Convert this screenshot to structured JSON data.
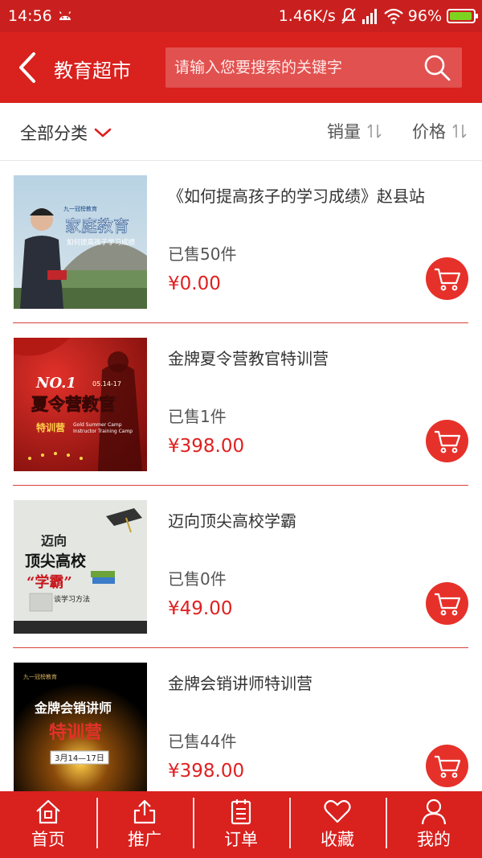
{
  "status_bar": {
    "time": "14:56",
    "network_speed": "1.46K/s",
    "battery": "96%"
  },
  "header": {
    "title": "教育超市",
    "search_placeholder": "请输入您要搜索的关键字"
  },
  "filter_bar": {
    "category_label": "全部分类",
    "sort_sales_label": "销量",
    "sort_price_label": "价格"
  },
  "products": [
    {
      "name": "《如何提高孩子的学习成绩》赵县站",
      "sold": "已售50件",
      "price": "¥0.00",
      "thumb_text": {
        "logo": "九一冠榜教育",
        "title": "家庭教育",
        "subtitle": "如何提高孩子学习成绩"
      }
    },
    {
      "name": "金牌夏令营教官特训营",
      "sold": "已售1件",
      "price": "¥398.00",
      "thumb_text": {
        "no1": "NO.1",
        "date": "05.14-17",
        "title": "夏令营教官",
        "sub": "特训营",
        "en1": "Gold Summer Camp",
        "en2": "Instructor Training Camp"
      }
    },
    {
      "name": "迈向顶尖高校学霸",
      "sold": "已售0件",
      "price": "¥49.00",
      "thumb_text": {
        "line1": "迈向",
        "line2": "顶尖高校",
        "line3": "“学霸”",
        "line4": "谈学习方法"
      }
    },
    {
      "name": "金牌会销讲师特训营",
      "sold": "已售44件",
      "price": "¥398.00",
      "thumb_text": {
        "logo": "九一冠榜教育",
        "title": "金牌会销讲师",
        "sub": "特训营",
        "date": "3月14—17日"
      }
    }
  ],
  "bottom_nav": [
    {
      "label": "首页",
      "icon": "home-icon"
    },
    {
      "label": "推广",
      "icon": "share-icon"
    },
    {
      "label": "订单",
      "icon": "order-icon"
    },
    {
      "label": "收藏",
      "icon": "heart-icon"
    },
    {
      "label": "我的",
      "icon": "user-icon"
    }
  ],
  "colors": {
    "brand_red": "#d9211e",
    "price_red": "#e02020",
    "cart_red": "#e6312a"
  }
}
